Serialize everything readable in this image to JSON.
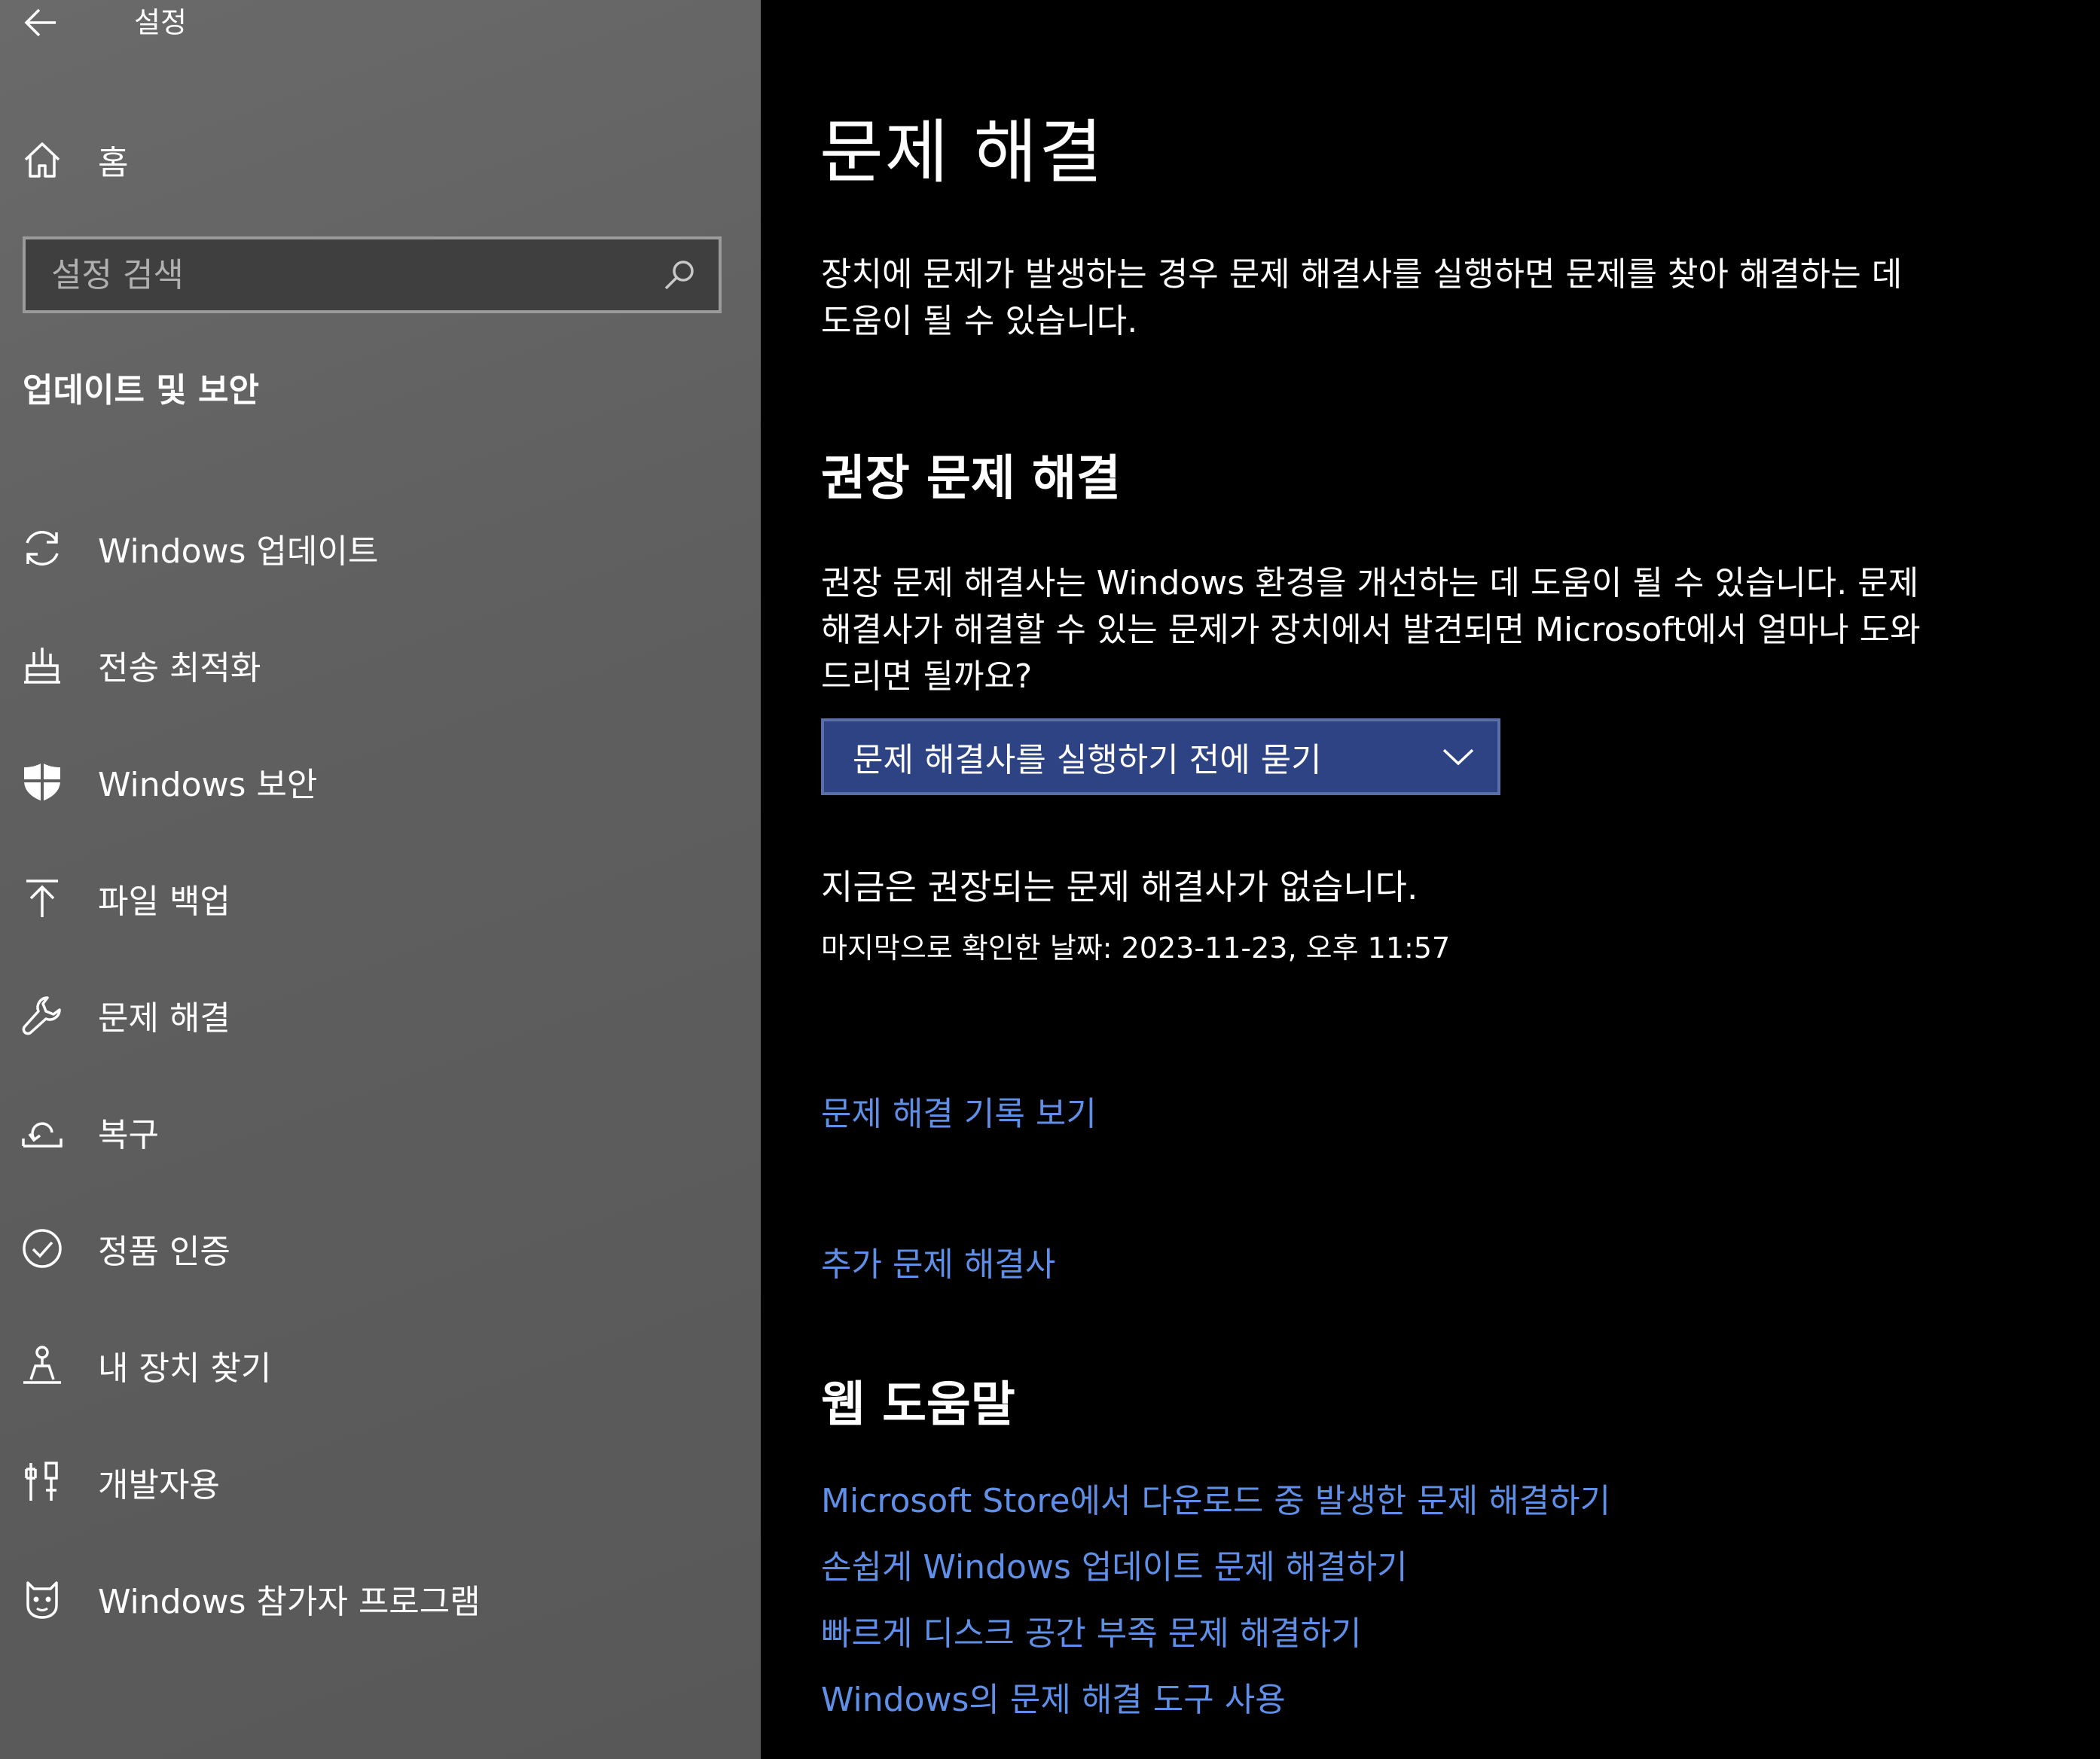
{
  "titlebar": {
    "title": "설정",
    "back_icon": "arrow-left-icon"
  },
  "sidebar": {
    "home": {
      "label": "홈",
      "icon": "home-icon"
    },
    "search": {
      "placeholder": "설정 검색",
      "value": "",
      "icon": "search-icon"
    },
    "section_title": "업데이트 및 보안",
    "items": [
      {
        "label": "Windows 업데이트",
        "icon": "refresh-icon"
      },
      {
        "label": "전송 최적화",
        "icon": "delivery-optimization-icon"
      },
      {
        "label": "Windows 보안",
        "icon": "shield-icon"
      },
      {
        "label": "파일 백업",
        "icon": "arrow-up-icon"
      },
      {
        "label": "문제 해결",
        "icon": "wrench-icon",
        "selected": true
      },
      {
        "label": "복구",
        "icon": "recovery-icon"
      },
      {
        "label": "정품 인증",
        "icon": "check-circle-icon"
      },
      {
        "label": "내 장치 찾기",
        "icon": "find-device-icon"
      },
      {
        "label": "개발자용",
        "icon": "developer-icon"
      },
      {
        "label": "Windows 참가자 프로그램",
        "icon": "insider-icon"
      }
    ]
  },
  "main": {
    "title": "문제 해결",
    "description": "장치에 문제가 발생하는 경우 문제 해결사를 실행하면 문제를 찾아 해결하는 데 도움이 될 수 있습니다.",
    "recommended": {
      "heading": "권장 문제 해결",
      "description": "권장 문제 해결사는 Windows 환경을 개선하는 데 도움이 될 수 있습니다. 문제 해결사가 해결할 수 있는 문제가 장치에서 발견되면 Microsoft에서 얼마나 도와드리면 될까요?",
      "dropdown_value": "문제 해결사를 실행하기 전에 묻기",
      "none_text": "지금은 권장되는 문제 해결사가 없습니다.",
      "last_checked": "마지막으로 확인한 날짜: 2023-11-23, 오후 11:57"
    },
    "history_link": "문제 해결 기록 보기",
    "more_link": "추가 문제 해결사",
    "web_help": {
      "heading": "웹 도움말",
      "links": [
        "Microsoft Store에서 다운로드 중 발생한 문제 해결하기",
        "손쉽게 Windows 업데이트 문제 해결하기",
        "빠르게 디스크 공간 부족 문제 해결하기",
        "Windows의 문제 해결 도구 사용"
      ]
    }
  },
  "colors": {
    "sidebar_bg": "#626262",
    "main_bg": "#000000",
    "link": "#5f8fe6",
    "dropdown_bg": "#2d4384"
  }
}
